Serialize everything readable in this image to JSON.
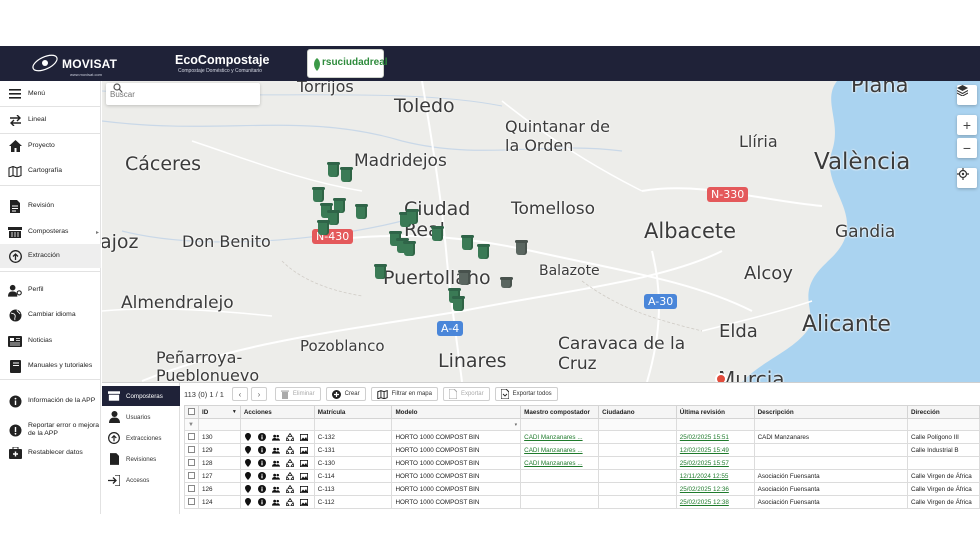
{
  "header": {
    "brand": "MOVISAT",
    "brand_url": "www.movisat.com",
    "product_title": "EcoCompostaje",
    "product_subtitle": "Compostaje Doméstico y Comunitario",
    "partner_logo": "rsuciudadreal"
  },
  "sidebar": {
    "items": [
      {
        "label": "Menú",
        "icon": "menu-icon"
      },
      {
        "label": "Lineal",
        "icon": "swap-icon"
      },
      {
        "label": "Proyecto",
        "icon": "home-icon"
      },
      {
        "label": "Cartografía",
        "icon": "map-icon"
      },
      {
        "label": "Revisión",
        "icon": "document-icon"
      },
      {
        "label": "Composteras",
        "icon": "compost-bin-icon"
      },
      {
        "label": "Extracción",
        "icon": "upload-circle-icon"
      },
      {
        "label": "Perfil",
        "icon": "user-gear-icon"
      },
      {
        "label": "Cambiar idioma",
        "icon": "globe-icon"
      },
      {
        "label": "Noticias",
        "icon": "newspaper-icon"
      },
      {
        "label": "Manuales y tutoriales",
        "icon": "book-icon"
      },
      {
        "label": "Información de la APP",
        "icon": "info-icon"
      },
      {
        "label": "Reportar error o mejora de la APP",
        "icon": "alert-icon"
      },
      {
        "label": "Restablecer datos",
        "icon": "medkit-icon"
      }
    ]
  },
  "map": {
    "search_placeholder": "Buscar",
    "cities": [
      {
        "name": "Torrijos"
      },
      {
        "name": "Toledo"
      },
      {
        "name": "Plana"
      },
      {
        "name": "Quintanar de la Orden"
      },
      {
        "name": "Llíria"
      },
      {
        "name": "Cáceres"
      },
      {
        "name": "Madridejos"
      },
      {
        "name": "València"
      },
      {
        "name": "Ciudad Real"
      },
      {
        "name": "Tomelloso"
      },
      {
        "name": "Albacete"
      },
      {
        "name": "Gandia"
      },
      {
        "name": "ajoz"
      },
      {
        "name": "Don Benito"
      },
      {
        "name": "Puertollano"
      },
      {
        "name": "Balazote"
      },
      {
        "name": "Alcoy"
      },
      {
        "name": "Almendralejo"
      },
      {
        "name": "Elda"
      },
      {
        "name": "Alicante"
      },
      {
        "name": "Pozoblanco"
      },
      {
        "name": "Linares"
      },
      {
        "name": "Caravaca de la Cruz"
      },
      {
        "name": "Peñarroya-Pueblonuevo"
      },
      {
        "name": "Murcia"
      }
    ],
    "roads": [
      "N-430",
      "N-330",
      "A-30",
      "A-4"
    ],
    "controls": [
      "layers-icon",
      "zoom-in-icon",
      "zoom-out-icon",
      "locate-icon"
    ]
  },
  "bottom": {
    "subnav": [
      {
        "label": "Composteras",
        "icon": "compost-bin-icon"
      },
      {
        "label": "Usuarios",
        "icon": "user-icon"
      },
      {
        "label": "Extracciones",
        "icon": "upload-circle-icon"
      },
      {
        "label": "Revisiones",
        "icon": "document-icon"
      },
      {
        "label": "Accesos",
        "icon": "login-icon"
      }
    ],
    "toolbar": {
      "count": "113",
      "selected": "(0)",
      "pages": "1 / 1",
      "delete": "Eliminar",
      "create": "Crear",
      "filter_map": "Filtrar en mapa",
      "export": "Exportar",
      "export_all": "Exportar todos"
    },
    "columns": [
      "ID",
      "Acciones",
      "Matrícula",
      "Modelo",
      "Maestro compostador",
      "Ciudadano",
      "Última revisión",
      "Descripción",
      "Dirección"
    ],
    "rows": [
      {
        "id": "130",
        "matricula": "C-132",
        "modelo": "HORTO 1000 COMPOST BIN",
        "maestro": "CADI Manzanares ...",
        "ciudadano": "",
        "revision": "25/02/2025 15:51",
        "descripcion": "CADI Manzanares",
        "direccion": "Calle Polígono III"
      },
      {
        "id": "129",
        "matricula": "C-131",
        "modelo": "HORTO 1000 COMPOST BIN",
        "maestro": "CADI Manzanares ...",
        "ciudadano": "",
        "revision": "12/02/2025 15:49",
        "descripcion": "",
        "direccion": "Calle Industrial B"
      },
      {
        "id": "128",
        "matricula": "C-130",
        "modelo": "HORTO 1000 COMPOST BIN",
        "maestro": "CADI Manzanares ...",
        "ciudadano": "",
        "revision": "25/02/2025 15:57",
        "descripcion": "",
        "direccion": ""
      },
      {
        "id": "127",
        "matricula": "C-114",
        "modelo": "HORTO 1000 COMPOST BIN",
        "maestro": "",
        "ciudadano": "",
        "revision": "12/11/2024 12:55",
        "descripcion": "Asociación Fuensanta",
        "direccion": "Calle Virgen de África"
      },
      {
        "id": "126",
        "matricula": "C-113",
        "modelo": "HORTO 1000 COMPOST BIN",
        "maestro": "",
        "ciudadano": "",
        "revision": "25/02/2025 12:36",
        "descripcion": "Asociación Fuensanta",
        "direccion": "Calle Virgen de África"
      },
      {
        "id": "124",
        "matricula": "C-112",
        "modelo": "HORTO 1000 COMPOST BIN",
        "maestro": "",
        "ciudadano": "",
        "revision": "25/02/2025 12:38",
        "descripcion": "Asociación Fuensanta",
        "direccion": "Calle Virgen de África"
      }
    ]
  }
}
